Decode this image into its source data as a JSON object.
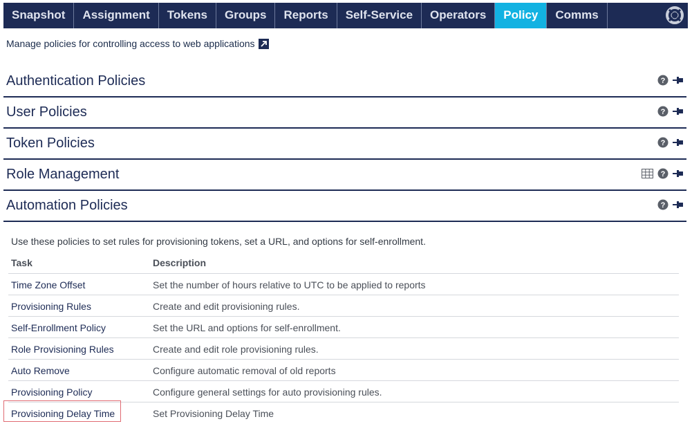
{
  "nav": {
    "tabs": [
      {
        "label": "Snapshot"
      },
      {
        "label": "Assignment"
      },
      {
        "label": "Tokens"
      },
      {
        "label": "Groups"
      },
      {
        "label": "Reports"
      },
      {
        "label": "Self-Service"
      },
      {
        "label": "Operators"
      },
      {
        "label": "Policy"
      },
      {
        "label": "Comms"
      }
    ],
    "active_tab": "Policy",
    "help_icon": "lifebuoy-icon"
  },
  "intro": {
    "text": "Manage policies for controlling access to web applications",
    "icon": "external-link-icon"
  },
  "sections": [
    {
      "title": "Authentication Policies"
    },
    {
      "title": "User Policies"
    },
    {
      "title": "Token Policies"
    },
    {
      "title": "Role Management"
    },
    {
      "title": "Automation Policies"
    }
  ],
  "automation": {
    "description": "Use these policies to set rules for provisioning tokens, set a URL, and options for self-enrollment.",
    "headers": {
      "task": "Task",
      "description": "Description"
    },
    "rows": [
      {
        "task": "Time Zone Offset",
        "description": "Set the number of hours relative to UTC to be applied to reports"
      },
      {
        "task": "Provisioning Rules",
        "description": "Create and edit provisioning rules."
      },
      {
        "task": "Self-Enrollment Policy",
        "description": "Set the URL and options for self-enrollment."
      },
      {
        "task": "Role Provisioning Rules",
        "description": "Create and edit role provisioning rules."
      },
      {
        "task": "Auto Remove",
        "description": "Configure automatic removal of old reports"
      },
      {
        "task": "Provisioning Policy",
        "description": "Configure general settings for auto provisioning rules."
      },
      {
        "task": "Provisioning Delay Time",
        "description": "Set Provisioning Delay Time"
      }
    ]
  },
  "colors": {
    "nav_bg": "#1d2b55",
    "active_tab": "#12b2e2",
    "highlight_border": "#e06a72"
  }
}
